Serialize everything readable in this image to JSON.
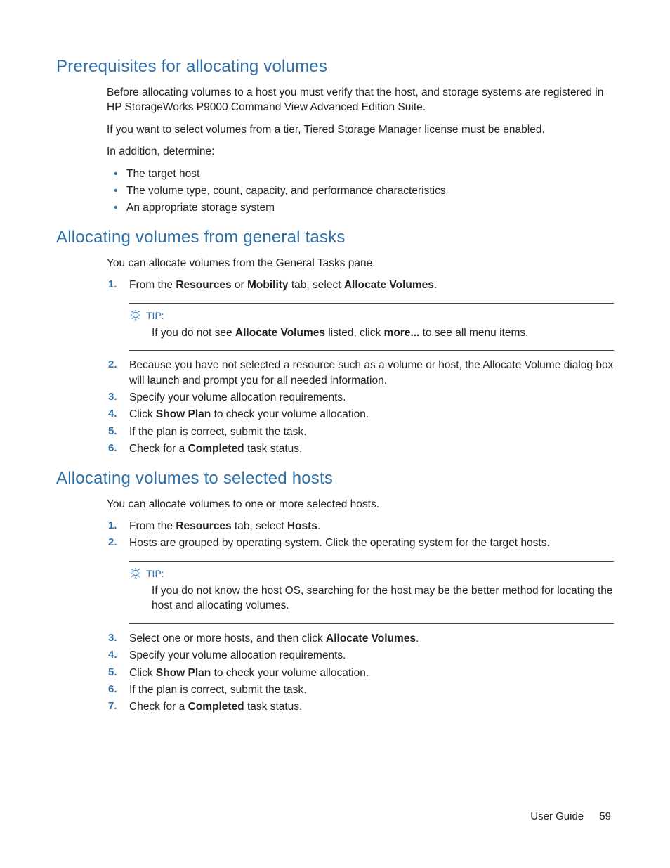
{
  "tipLabel": "TIP:",
  "footer": {
    "label": "User Guide",
    "page": "59"
  },
  "s1": {
    "heading": "Prerequisites for allocating volumes",
    "p1": "Before allocating volumes to a host you must verify that the host, and storage systems are registered in HP StorageWorks P9000 Command View Advanced Edition Suite.",
    "p2": "If you want to select volumes from a tier, Tiered Storage Manager license must be enabled.",
    "p3": "In addition, determine:",
    "bullets": {
      "b0": "The target host",
      "b1": "The volume type, count, capacity, and performance characteristics",
      "b2": "An appropriate storage system"
    }
  },
  "s2": {
    "heading": "Allocating volumes from general tasks",
    "intro": "You can allocate volumes from the General Tasks pane.",
    "step1": {
      "a": "From the ",
      "b": "Resources",
      "c": " or ",
      "d": "Mobility",
      "e": " tab, select ",
      "f": "Allocate Volumes",
      "g": "."
    },
    "tip": {
      "a": "If you do not see ",
      "b": "Allocate Volumes",
      "c": " listed, click ",
      "d": "more...",
      "e": " to see all menu items."
    },
    "step2": "Because you have not selected a resource such as a volume or host, the Allocate Volume dialog box will launch and prompt you for all needed information.",
    "step3": "Specify your volume allocation requirements.",
    "step4": {
      "a": "Click ",
      "b": "Show Plan",
      "c": " to check your volume allocation."
    },
    "step5": "If the plan is correct, submit the task.",
    "step6": {
      "a": "Check for a ",
      "b": "Completed",
      "c": " task status."
    }
  },
  "s3": {
    "heading": "Allocating volumes to selected hosts",
    "intro": "You can allocate volumes to one or more selected hosts.",
    "step1": {
      "a": "From the ",
      "b": "Resources",
      "c": " tab, select ",
      "d": "Hosts",
      "e": "."
    },
    "step2": "Hosts are grouped by operating system. Click the operating system for the target hosts.",
    "tip": "If you do not know the host OS, searching for the host may be the better method for locating the host and allocating volumes.",
    "step3": {
      "a": "Select one or more hosts, and then click ",
      "b": "Allocate Volumes",
      "c": "."
    },
    "step4": "Specify your volume allocation requirements.",
    "step5": {
      "a": "Click ",
      "b": "Show Plan",
      "c": " to check your volume allocation."
    },
    "step6": "If the plan is correct, submit the task.",
    "step7": {
      "a": "Check for a ",
      "b": "Completed",
      "c": " task status."
    }
  }
}
